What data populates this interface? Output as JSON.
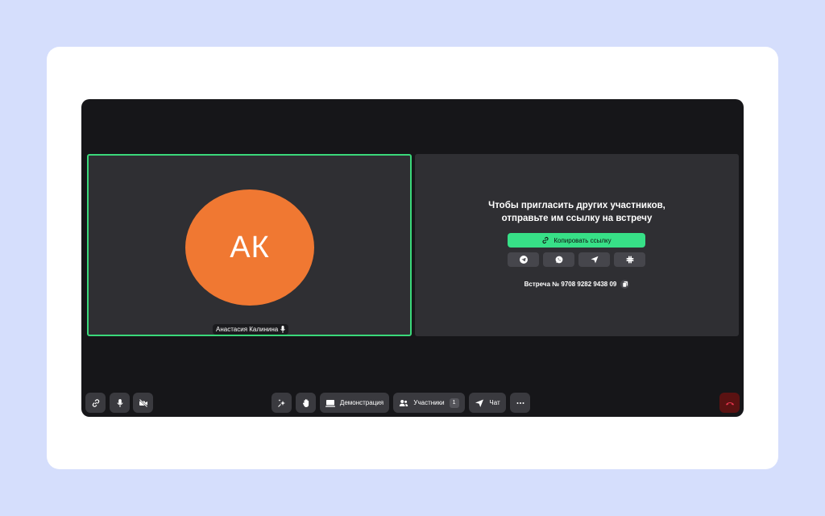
{
  "participant": {
    "initials": "АК",
    "name": "Анастасия Калинина",
    "avatar_color": "#f07832",
    "active_border_color": "#3ad87a"
  },
  "invite": {
    "line1": "Чтобы пригласить других участников,",
    "line2": "отправьте им ссылку на встречу",
    "copy_link_label": "Копировать ссылку",
    "share_icons": [
      "telegram-icon",
      "whatsapp-icon",
      "send-icon",
      "slack-icon"
    ],
    "meeting_id": "Встреча № 9708 9282 9438 09"
  },
  "toolbar": {
    "left": [
      "link-icon",
      "microphone-icon",
      "camera-off-icon"
    ],
    "center": {
      "effects_icon": "sparkles-icon",
      "raise_hand_icon": "hand-icon",
      "screen_share_label": "Демонстрация",
      "participants_label": "Участники",
      "participants_count": "1",
      "chat_label": "Чат",
      "more_icon": "more-icon"
    },
    "end_call_icon": "hang-up-icon",
    "end_call_color": "#e0334a"
  },
  "colors": {
    "page_bg": "#d5defc",
    "stage_bg": "#161619",
    "tile_bg": "#2f2f33",
    "accent_green": "#37e087"
  }
}
